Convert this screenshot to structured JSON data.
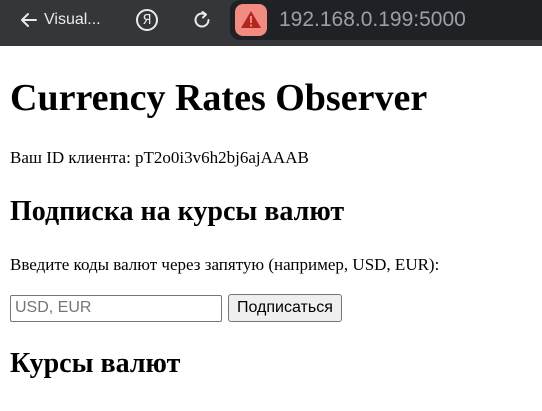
{
  "browser": {
    "tab_title": "Visual...",
    "url": "192.168.0.199:5000",
    "yandex_glyph": "Я",
    "icons": [
      "back-arrow-icon",
      "yandex-icon",
      "reload-icon",
      "warning-icon"
    ],
    "colors": {
      "toolbar": "#35363a",
      "address_bar": "#202124",
      "warning": "#f28b82",
      "url_text": "#9aa0a6"
    }
  },
  "page": {
    "title": "Currency Rates Observer",
    "client_id_text": "Ваш ID клиента: pT2o0i3v6h2bj6ajAAAB",
    "subscribe_heading": "Подписка на курсы валют",
    "instructions": "Введите коды валют через запятую (например, USD, EUR):",
    "currency_input": {
      "placeholder": "USD, EUR",
      "value": ""
    },
    "subscribe_button": "Подписаться",
    "rates_heading": "Курсы валют"
  }
}
